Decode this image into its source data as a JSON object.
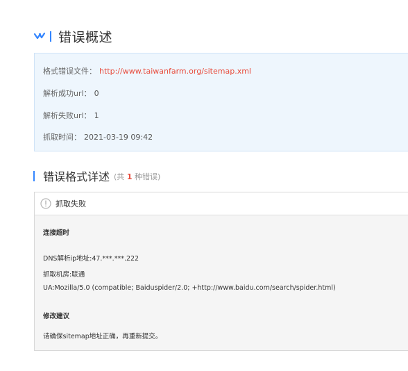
{
  "overview": {
    "title": "错误概述",
    "rows": {
      "file_label": "格式错误文件：",
      "file_url": "http://www.taiwanfarm.org/sitemap.xml",
      "success_label": "解析成功url：",
      "success_value": "0",
      "fail_label": "解析失败url：",
      "fail_value": "1",
      "time_label": "抓取时间：",
      "time_value": "2021-03-19 09:42"
    }
  },
  "detail": {
    "title": "错误格式详述",
    "count_prefix": "(共",
    "count_value": "1",
    "count_suffix": "种错误)"
  },
  "error_panel": {
    "head_label": "抓取失败",
    "reason": "连接超时",
    "dns": "DNS解析ip地址:47.***.***.222",
    "room": "抓取机房:联通",
    "ua": "UA:Mozilla/5.0 (compatible; Baiduspider/2.0; +http://www.baidu.com/search/spider.html)",
    "suggest_title": "修改建议",
    "suggest_text": "请确保sitemap地址正确，再重新提交。"
  },
  "colors": {
    "accent": "#3385ff",
    "link_red": "#e84c3d",
    "summary_bg": "#eef6fd"
  }
}
